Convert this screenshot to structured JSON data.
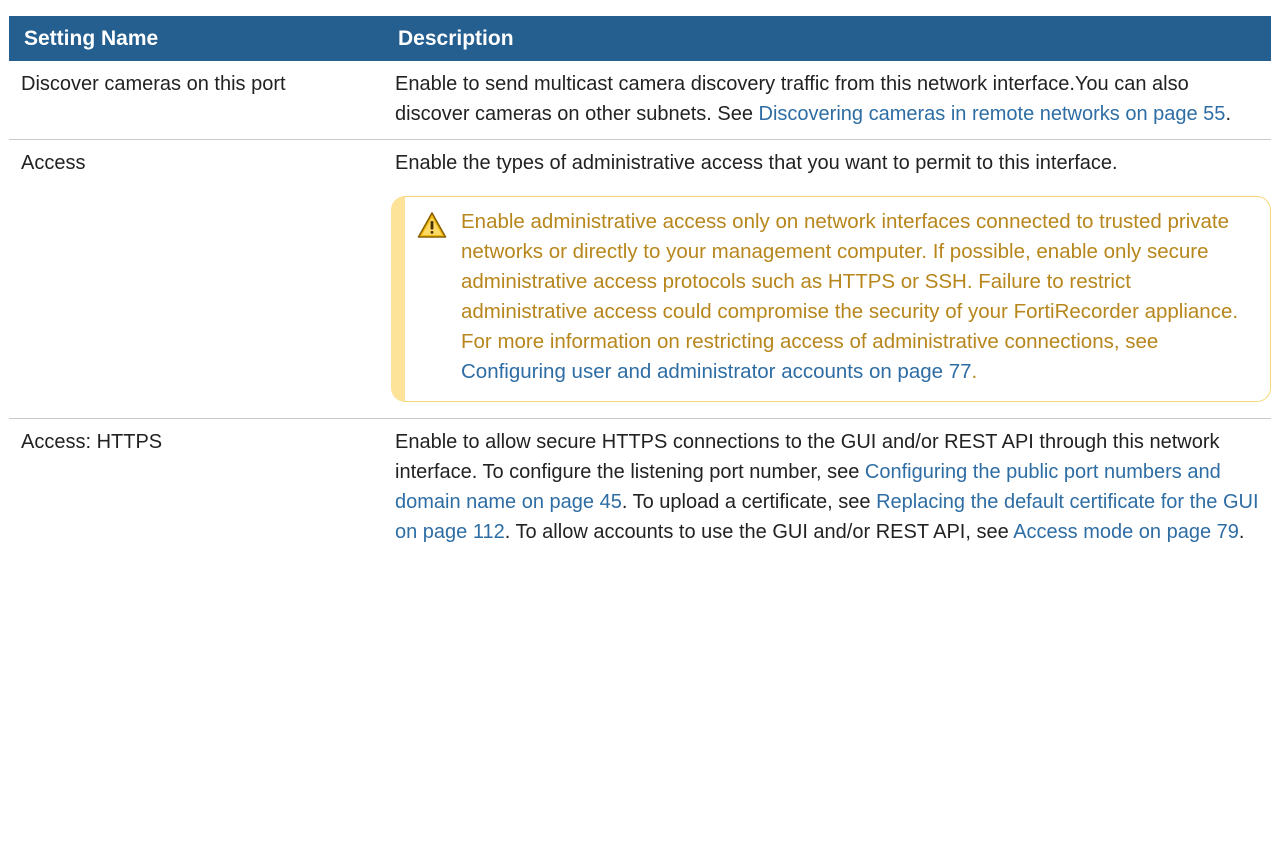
{
  "table": {
    "headers": {
      "name": "Setting Name",
      "description": "Description"
    },
    "discover": {
      "name": "Discover cameras on this port",
      "text": "Enable to send multicast camera discovery traffic from this network interface.You can also discover cameras on other subnets. See ",
      "link": "Discovering cameras in remote networks on page 55",
      "end": "."
    },
    "access": {
      "name": "Access",
      "text": "Enable the types of administrative access that you want to permit to this interface.",
      "warning": {
        "icon": "warning-triangle-icon",
        "text": "Enable administrative access only on network interfaces connected to trusted private networks or directly to your management computer. If possible, enable only secure administrative access protocols such as HTTPS or SSH. Failure to restrict administrative access could compromise the security of your FortiRecorder appliance. For more information on restricting access of administrative connections, see ",
        "link": "Configuring user and administrator accounts on page 77",
        "end": "."
      }
    },
    "https": {
      "name": "Access: HTTPS",
      "t1": "Enable to allow secure HTTPS connections to the GUI and/or REST API through this network interface. To configure the listening port number, see ",
      "l1": "Configuring the public port numbers and domain name on page 45",
      "t2": ". To upload a certificate, see ",
      "l2": "Replacing the default certificate for the GUI on page 112",
      "t3": ". To allow accounts to use the GUI and/or REST API, see ",
      "l3": "Access mode on page 79",
      "t4": "."
    }
  },
  "colors": {
    "header_bg": "#245f8f",
    "link": "#2e6da4",
    "warning_text": "#b7861c",
    "warning_border": "#fde29a"
  }
}
